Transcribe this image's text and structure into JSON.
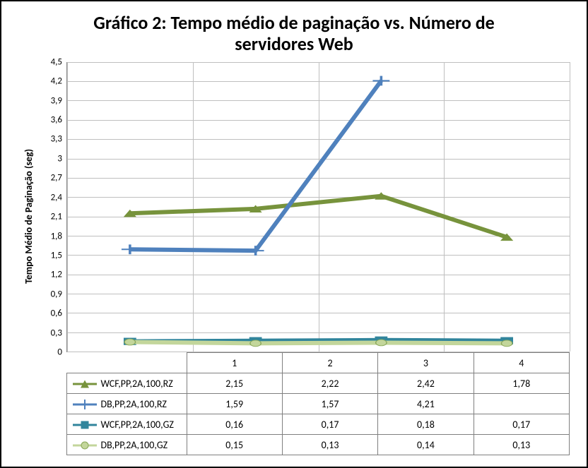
{
  "title_line1": "Gráfico 2: Tempo médio de paginação vs. Número de",
  "title_line2": "servidores Web",
  "ylabel": "Tempo Médio de Paginação (seg)",
  "colors": {
    "s1": "#77933C",
    "s2": "#4F81BD",
    "s3": "#31859C",
    "s4": "#C3D69B",
    "grid": "#bfbfbf",
    "axis": "#888888"
  },
  "chart_data": {
    "type": "line",
    "title": "Gráfico 2: Tempo médio de paginação vs. Número de servidores Web",
    "xlabel": "",
    "ylabel": "Tempo Médio de Paginação (seg)",
    "categories": [
      "1",
      "2",
      "3",
      "4"
    ],
    "y_ticks": [
      0,
      0.3,
      0.6,
      0.9,
      1.2,
      1.5,
      1.8,
      2.1,
      2.4,
      2.7,
      3,
      3.3,
      3.6,
      3.9,
      4.2,
      4.5
    ],
    "y_tick_labels": [
      "0",
      "0,3",
      "0,6",
      "0,9",
      "1,2",
      "1,5",
      "1,8",
      "2,1",
      "2,4",
      "2,7",
      "3",
      "3,3",
      "3,6",
      "3,9",
      "4,2",
      "4,5"
    ],
    "ylim": [
      0,
      4.5
    ],
    "grid": true,
    "legend_position": "bottom-table",
    "series": [
      {
        "name": "WCF,PP,2A,100,RZ",
        "marker": "triangle",
        "color": "#77933C",
        "values": [
          2.15,
          2.22,
          2.42,
          1.78
        ],
        "value_labels": [
          "2,15",
          "2,22",
          "2,42",
          "1,78"
        ]
      },
      {
        "name": "DB,PP,2A,100,RZ",
        "marker": "plus",
        "color": "#4F81BD",
        "values": [
          1.59,
          1.57,
          4.21,
          null
        ],
        "value_labels": [
          "1,59",
          "1,57",
          "4,21",
          ""
        ]
      },
      {
        "name": "WCF,PP,2A,100,GZ",
        "marker": "square",
        "color": "#31859C",
        "values": [
          0.16,
          0.17,
          0.18,
          0.17
        ],
        "value_labels": [
          "0,16",
          "0,17",
          "0,18",
          "0,17"
        ]
      },
      {
        "name": "DB,PP,2A,100,GZ",
        "marker": "circle",
        "color": "#C3D69B",
        "values": [
          0.15,
          0.13,
          0.14,
          0.13
        ],
        "value_labels": [
          "0,15",
          "0,13",
          "0,14",
          "0,13"
        ]
      }
    ]
  }
}
